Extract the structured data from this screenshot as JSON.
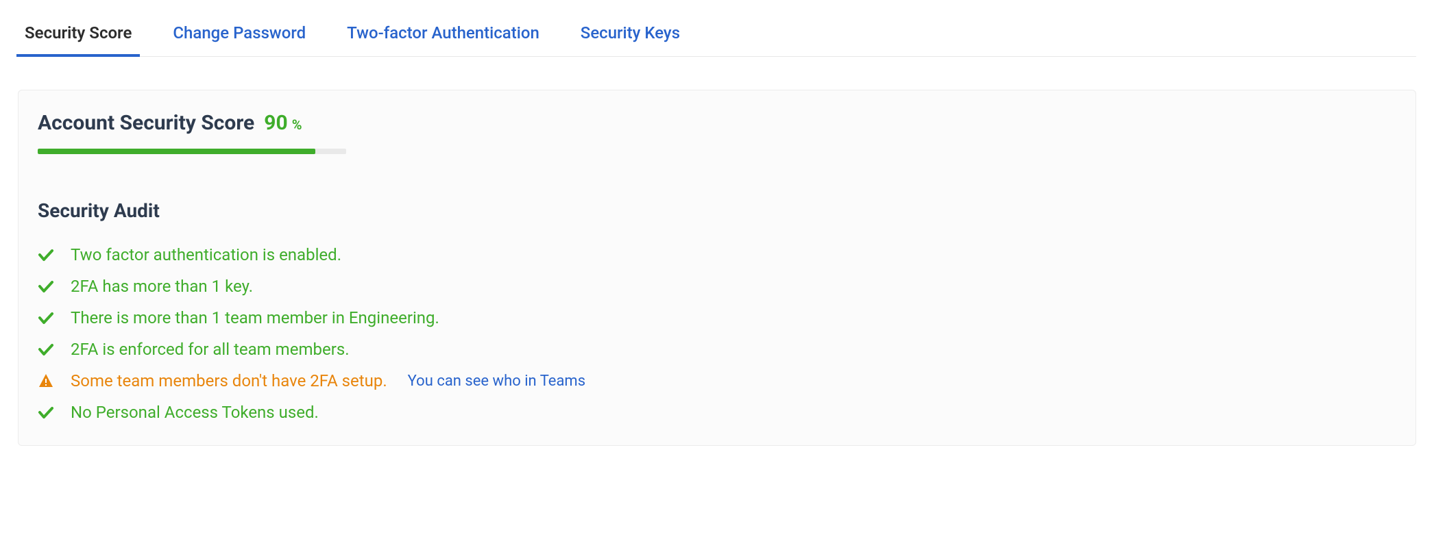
{
  "tabs": [
    {
      "label": "Security Score",
      "active": true
    },
    {
      "label": "Change Password",
      "active": false
    },
    {
      "label": "Two-factor Authentication",
      "active": false
    },
    {
      "label": "Security Keys",
      "active": false
    }
  ],
  "score": {
    "label": "Account Security Score",
    "value": "90",
    "percent_symbol": "%",
    "progress_percent": 90
  },
  "audit": {
    "heading": "Security Audit",
    "items": [
      {
        "status": "ok",
        "text": "Two factor authentication is enabled."
      },
      {
        "status": "ok",
        "text": "2FA has more than 1 key."
      },
      {
        "status": "ok",
        "text": "There is more than 1 team member in Engineering."
      },
      {
        "status": "ok",
        "text": "2FA is enforced for all team members."
      },
      {
        "status": "warn",
        "text": "Some team members don't have 2FA setup.",
        "link": "You can see who in Teams"
      },
      {
        "status": "ok",
        "text": "No Personal Access Tokens used."
      }
    ]
  },
  "colors": {
    "accent": "#2863cc",
    "success": "#3fad2b",
    "warning": "#e8850c"
  }
}
